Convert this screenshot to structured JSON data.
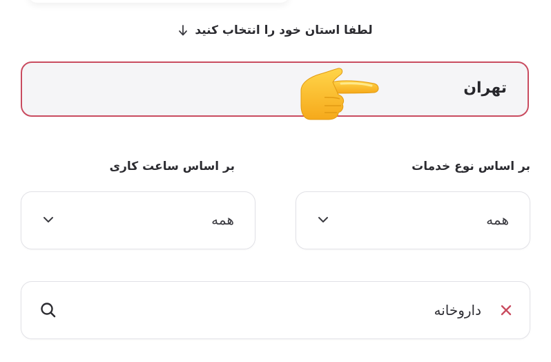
{
  "province": {
    "prompt_label": "لطفا استان خود را انتخاب کنید",
    "selected_value": "تهران"
  },
  "filters": {
    "service_type": {
      "label": "بر اساس نوع خدمات",
      "value": "همه"
    },
    "working_hours": {
      "label": "بر اساس ساعت کاری",
      "value": "همه"
    }
  },
  "search": {
    "value": "داروخانه"
  },
  "icons": {
    "prompt_arrow": "arrow-down-icon",
    "pointer": "pointing-hand-icon",
    "dropdown_chevron": "chevron-down-icon",
    "clear": "clear-icon",
    "search": "search-icon"
  },
  "colors": {
    "accent": "#c94b5f",
    "field_bg": "#f5f5f7",
    "border": "#e1e1e6",
    "text": "#26262b"
  }
}
